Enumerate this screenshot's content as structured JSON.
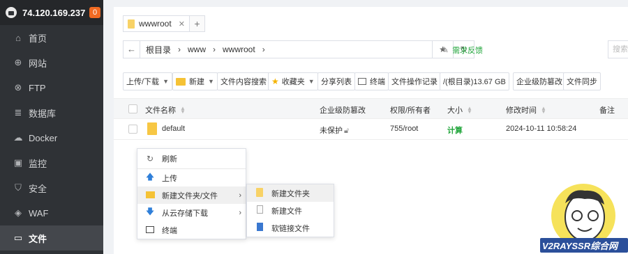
{
  "sidebar": {
    "ip": "74.120.169.237",
    "badge": "0",
    "items": [
      {
        "label": "首页",
        "icon": "home-icon",
        "glyph": "⌂"
      },
      {
        "label": "网站",
        "icon": "globe-icon",
        "glyph": "⊕"
      },
      {
        "label": "FTP",
        "icon": "ftp-icon",
        "glyph": "⊗"
      },
      {
        "label": "数据库",
        "icon": "database-icon",
        "glyph": "≣"
      },
      {
        "label": "Docker",
        "icon": "docker-icon",
        "glyph": "☁"
      },
      {
        "label": "监控",
        "icon": "monitor-icon",
        "glyph": "▣"
      },
      {
        "label": "安全",
        "icon": "shield-icon",
        "glyph": "⛉"
      },
      {
        "label": "WAF",
        "icon": "waf-icon",
        "glyph": "◈"
      },
      {
        "label": "文件",
        "icon": "folder-icon",
        "glyph": "▭"
      }
    ]
  },
  "tabs": [
    {
      "label": "wwwroot"
    }
  ],
  "path": {
    "crumbs": [
      "根目录",
      "www",
      "wwwroot"
    ],
    "feedback": "需求反馈",
    "search_placeholder": "搜索"
  },
  "toolbar": {
    "upload": "上传/下载",
    "new": "新建",
    "content_search": "文件内容搜索",
    "favorites": "收藏夹",
    "share_list": "分享列表",
    "terminal": "终端",
    "file_ops_log": "文件操作记录",
    "disk": "/(根目录)13.67 GB",
    "tamper": "企业级防篡改",
    "sync": "文件同步"
  },
  "table": {
    "headers": {
      "name": "文件名称",
      "tamper": "企业级防篡改",
      "perm": "权限/所有者",
      "size": "大小",
      "mtime": "修改时间",
      "note": "备注"
    },
    "rows": [
      {
        "name": "default",
        "tamper": "未保护",
        "perm": "755/root",
        "size": "计算",
        "mtime": "2024-10-11 10:58:24"
      }
    ]
  },
  "context_menu": {
    "items": [
      {
        "label": "刷新"
      },
      {
        "label": "上传"
      },
      {
        "label": "新建文件夹/文件"
      },
      {
        "label": "从云存储下载"
      },
      {
        "label": "终端"
      }
    ],
    "submenu": [
      {
        "label": "新建文件夹"
      },
      {
        "label": "新建文件"
      },
      {
        "label": "软链接文件"
      }
    ]
  },
  "watermark": {
    "text": "V2RAYSSR综合网"
  },
  "colors": {
    "sidebar_bg": "#2f3236",
    "accent_green": "#20a53a",
    "badge": "#f06a22"
  }
}
